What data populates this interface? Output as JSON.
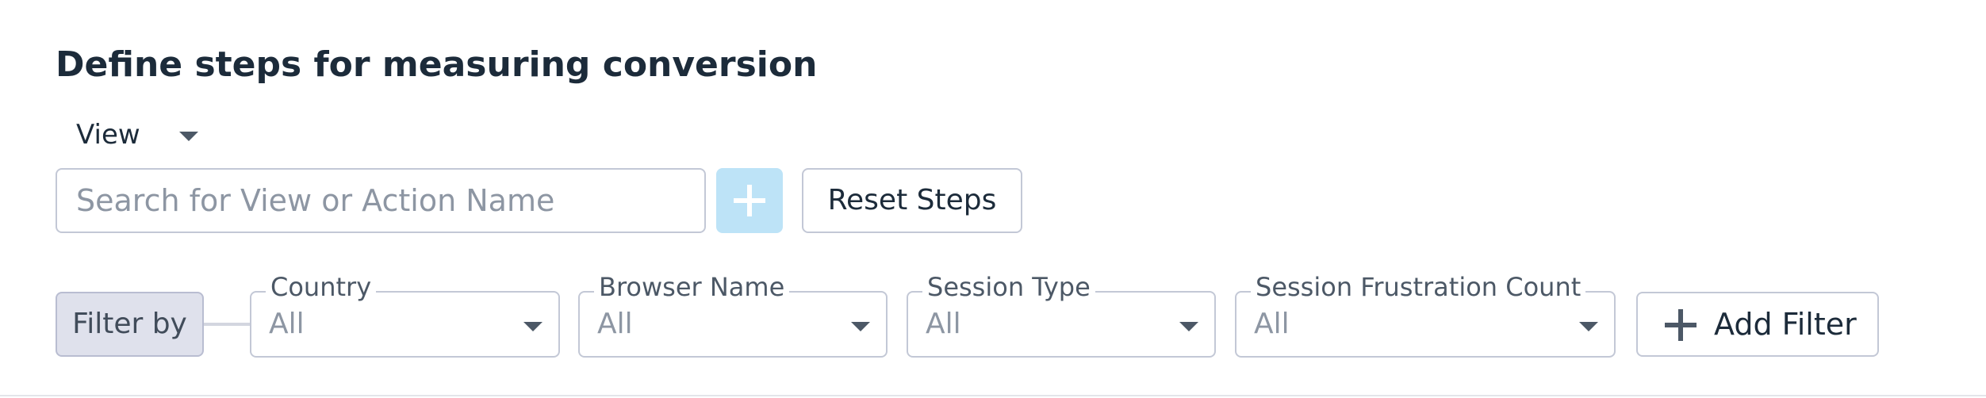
{
  "section": {
    "title": "Define steps for measuring conversion"
  },
  "step_type": {
    "selected": "View"
  },
  "search": {
    "placeholder": "Search for View or Action Name",
    "value": ""
  },
  "actions": {
    "add_step_icon": "plus-icon",
    "reset_label": "Reset Steps"
  },
  "filters": {
    "label": "Filter by",
    "items": [
      {
        "name": "Country",
        "value": "All"
      },
      {
        "name": "Browser Name",
        "value": "All"
      },
      {
        "name": "Session Type",
        "value": "All"
      },
      {
        "name": "Session Frustration Count",
        "value": "All"
      }
    ],
    "add_label": "Add Filter",
    "add_icon": "plus-icon"
  },
  "colors": {
    "add_step_bg": "#bde3f7",
    "filter_by_bg": "#dfe1ec",
    "border": "#c3c8d6"
  }
}
